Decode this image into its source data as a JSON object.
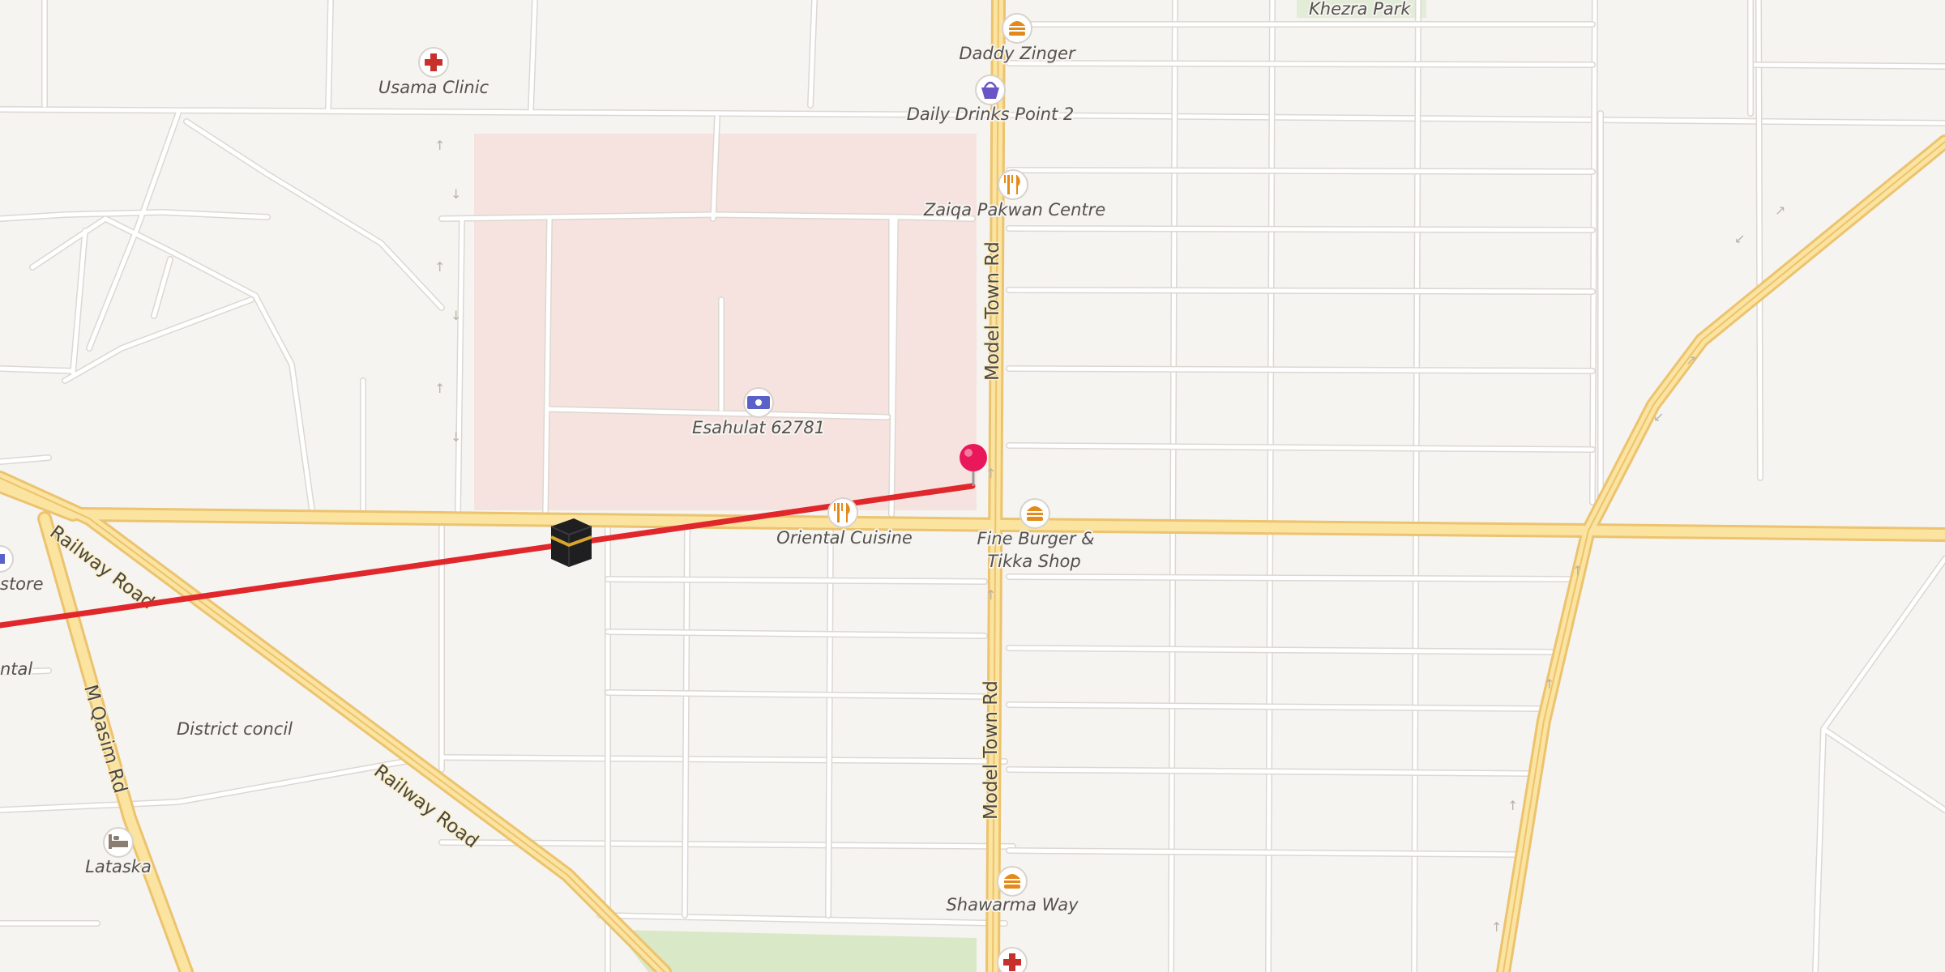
{
  "map": {
    "colors": {
      "background": "#f6f4f1",
      "major_road": "#fbe3a0",
      "major_road_casing": "#ecc36e",
      "minor_road": "#ffffff",
      "block_pink": "#f6e3e0",
      "park": "#d9e8c7",
      "route_line": "#e0282c",
      "poi_ring": "#ffffff"
    },
    "road_labels": {
      "model_town_rd_north": "Model Town Rd",
      "model_town_rd_south": "Model Town Rd",
      "railway_road_west": "Railway Road",
      "railway_road_south": "Railway Road",
      "m_qasim_rd": "M Qasim Rd"
    },
    "area_labels": {
      "khezra_park": "Khezra Park",
      "district_concil": "District concil",
      "store_partial": "store",
      "ntal_partial": "ntal"
    },
    "pois": [
      {
        "id": "usama-clinic",
        "name": "Usama Clinic",
        "icon": "medical-cross-icon",
        "color": "#c8302c"
      },
      {
        "id": "daddy-zinger",
        "name": "Daddy Zinger",
        "icon": "burger-icon",
        "color": "#e38a1a"
      },
      {
        "id": "daily-drinks",
        "name": "Daily Drinks Point 2",
        "icon": "shopping-basket-icon",
        "color": "#6a55c8"
      },
      {
        "id": "zaiqa-pakwan",
        "name": "Zaiqa Pakwan Centre",
        "icon": "fork-knife-icon",
        "color": "#e38a1a"
      },
      {
        "id": "esahulat",
        "name": "Esahulat 62781",
        "icon": "banknote-icon",
        "color": "#5a62c8"
      },
      {
        "id": "oriental-cuisine",
        "name": "Oriental Cuisine",
        "icon": "fork-knife-icon",
        "color": "#e38a1a"
      },
      {
        "id": "fine-burger",
        "name": "Fine Burger &",
        "name_line2": "Tikka Shop",
        "icon": "burger-icon",
        "color": "#e38a1a"
      },
      {
        "id": "shawarma-way",
        "name": "Shawarma Way",
        "icon": "burger-icon",
        "color": "#e38a1a"
      },
      {
        "id": "lataska",
        "name": "Lataska",
        "icon": "bed-icon",
        "color": "#8a7d72"
      }
    ],
    "markers": {
      "destination_pin": "map-pin-icon",
      "origin_marker": "kaaba-icon"
    }
  }
}
